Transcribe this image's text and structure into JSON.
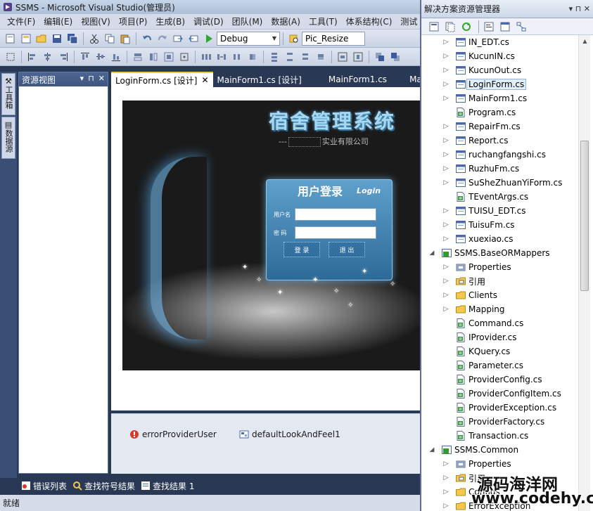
{
  "window": {
    "title": "SSMS - Microsoft Visual Studio(管理员)"
  },
  "menu": [
    "文件(F)",
    "编辑(E)",
    "视图(V)",
    "项目(P)",
    "生成(B)",
    "调试(D)",
    "团队(M)",
    "数据(A)",
    "工具(T)",
    "体系结构(C)",
    "测试"
  ],
  "toolbar": {
    "config": "Debug",
    "target": "Pic_Resize"
  },
  "left_strip": {
    "toolbox": "工具箱",
    "datasource": "数据源"
  },
  "resource_view": {
    "title": "资源视图",
    "pin": "⊓",
    "close": "✕",
    "menu": "▾"
  },
  "doc_tabs": [
    {
      "label": "LoginForm.cs [设计]",
      "close": "✕"
    },
    {
      "label": "MainForm1.cs [设计]"
    },
    {
      "label": "MainForm1.cs"
    },
    {
      "label": "Mai"
    }
  ],
  "login_form": {
    "system_title": "宿舍管理系统",
    "company_prefix": "---",
    "company_suffix": "实业有限公司",
    "panel_title_cn": "用户登录",
    "panel_title_en": "Login",
    "username_label": "用户名",
    "password_label": "密  码",
    "login_button": "登 录",
    "exit_button": "退 出"
  },
  "tray": {
    "item1": "errorProviderUser",
    "item2": "defaultLookAndFeel1"
  },
  "bottom_tabs": [
    "错误列表",
    "查找符号结果",
    "查找结果 1"
  ],
  "status": "就绪",
  "solution_explorer": {
    "title": "解决方案资源管理器",
    "controls": "▾ ⊓ ✕",
    "items": [
      {
        "label": "IN_EDT.cs",
        "type": "form"
      },
      {
        "label": "KucunIN.cs",
        "type": "form"
      },
      {
        "label": "KucunOut.cs",
        "type": "form"
      },
      {
        "label": "LoginForm.cs",
        "type": "form",
        "selected": true
      },
      {
        "label": "MainForm1.cs",
        "type": "form"
      },
      {
        "label": "Program.cs",
        "type": "cs"
      },
      {
        "label": "RepairFm.cs",
        "type": "form"
      },
      {
        "label": "Report.cs",
        "type": "form"
      },
      {
        "label": "ruchangfangshi.cs",
        "type": "form"
      },
      {
        "label": "RuzhuFm.cs",
        "type": "form"
      },
      {
        "label": "SuSheZhuanYiForm.cs",
        "type": "form"
      },
      {
        "label": "TEventArgs.cs",
        "type": "cs"
      },
      {
        "label": "TUISU_EDT.cs",
        "type": "form"
      },
      {
        "label": "TuisuFm.cs",
        "type": "form"
      },
      {
        "label": "xuexiao.cs",
        "type": "form"
      },
      {
        "label": "SSMS.BaseORMappers",
        "type": "project"
      },
      {
        "label": "Properties",
        "type": "properties"
      },
      {
        "label": "引用",
        "type": "references"
      },
      {
        "label": "Clients",
        "type": "folder"
      },
      {
        "label": "Mapping",
        "type": "folder"
      },
      {
        "label": "Command.cs",
        "type": "cs"
      },
      {
        "label": "IProvider.cs",
        "type": "cs"
      },
      {
        "label": "KQuery.cs",
        "type": "cs"
      },
      {
        "label": "Parameter.cs",
        "type": "cs"
      },
      {
        "label": "ProviderConfig.cs",
        "type": "cs"
      },
      {
        "label": "ProviderConfigItem.cs",
        "type": "cs"
      },
      {
        "label": "ProviderException.cs",
        "type": "cs"
      },
      {
        "label": "ProviderFactory.cs",
        "type": "cs"
      },
      {
        "label": "Transaction.cs",
        "type": "cs"
      },
      {
        "label": "SSMS.Common",
        "type": "project"
      },
      {
        "label": "Properties",
        "type": "properties"
      },
      {
        "label": "引用",
        "type": "references"
      },
      {
        "label": "Configs",
        "type": "folder"
      },
      {
        "label": "ErrorException",
        "type": "folder"
      }
    ]
  },
  "watermark": {
    "line1": "源码海洋网",
    "line2": "www.codehy.com"
  },
  "colors": {
    "vs_dark": "#293955",
    "accent_tab": "#f4c34f",
    "login_blue": "#3d7eab",
    "title_cyan": "#a8d8f0"
  }
}
